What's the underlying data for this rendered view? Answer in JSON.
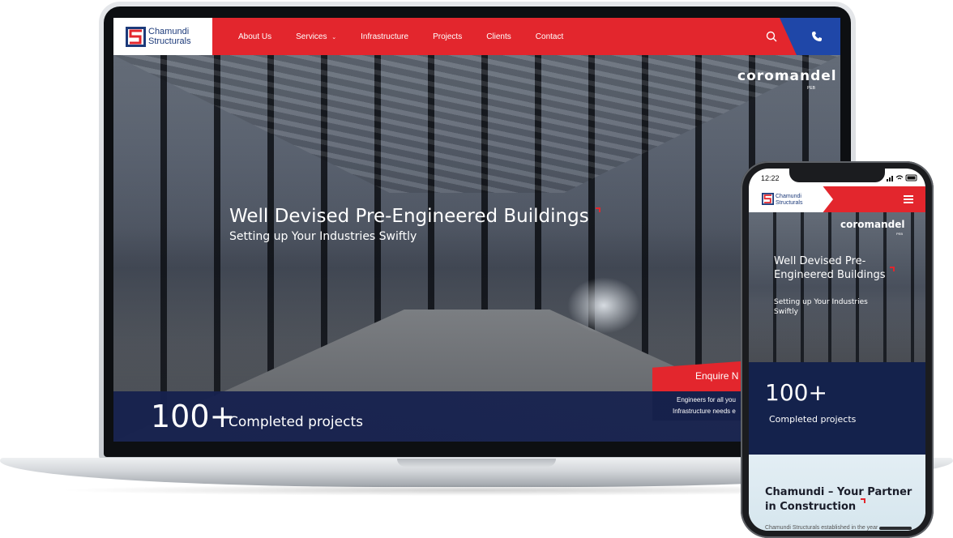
{
  "laptop": {
    "brand": {
      "line1": "Chamundi",
      "line2": "Structurals"
    },
    "nav": {
      "items": [
        "About Us",
        "Services",
        "Infrastructure",
        "Projects",
        "Clients",
        "Contact"
      ],
      "services_has_dropdown": true
    },
    "partner_logo": {
      "name": "coromandel",
      "tagline": "PEB"
    },
    "hero": {
      "title": "Well Devised Pre-Engineered Buildings",
      "subtitle": "Setting up Your Industries Swiftly"
    },
    "stats": {
      "number": "100+",
      "label": "Completed projects"
    },
    "enquire": {
      "label": "Enquire N",
      "lines": [
        "Engineers for all you",
        "Infrastructure needs e"
      ]
    }
  },
  "phone": {
    "status": {
      "time": "12:22"
    },
    "brand": {
      "line1": "Chamundi",
      "line2": "Structurals"
    },
    "partner_logo": {
      "name": "coromandel",
      "tagline": "PEB"
    },
    "hero": {
      "title": "Well Devised Pre-Engineered Buildings",
      "subtitle": "Setting up Your Industries Swiftly"
    },
    "stats": {
      "number": "100+",
      "label": "Completed projects"
    },
    "about": {
      "title": "Chamundi – Your Partner in Construction",
      "text": "Chamundi Structurals established in the year"
    }
  },
  "colors": {
    "brand_red": "#e3262d",
    "brand_blue": "#1f47a8",
    "navy": "#14224c"
  }
}
